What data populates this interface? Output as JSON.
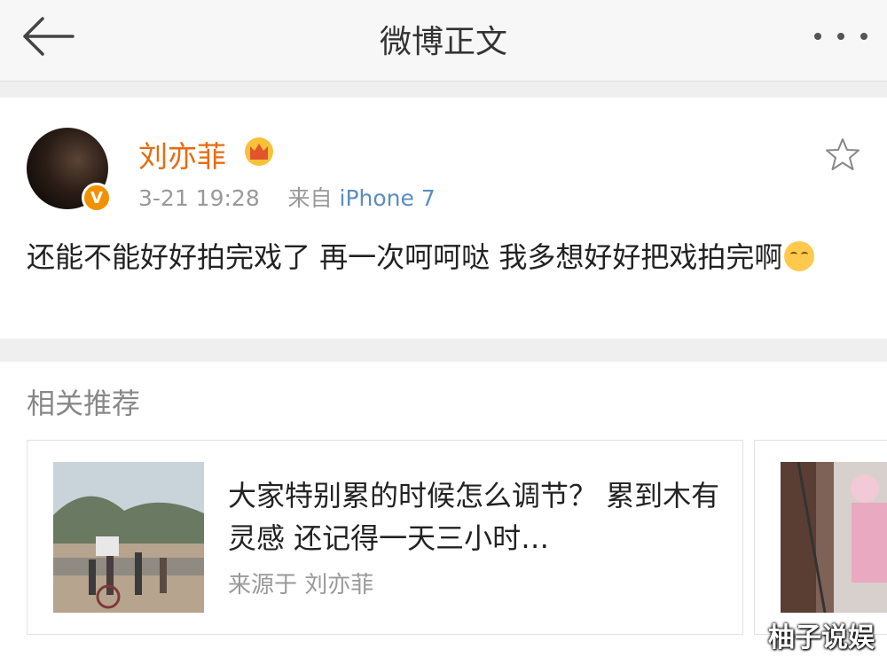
{
  "topbar": {
    "title": "微博正文",
    "back_icon": "arrow-left-icon",
    "more_icon": "more-dots-icon"
  },
  "post": {
    "username": "刘亦菲",
    "verified_badge": "V",
    "time": "3-21 19:28",
    "from_label": "来自",
    "source": "iPhone 7",
    "text": "还能不能好好拍完戏了 再一次呵呵哒 我多想好好把戏拍完啊",
    "emoji": "smile-emoji-icon",
    "favorite_icon": "star-outline-icon"
  },
  "recommend": {
    "title": "相关推荐",
    "cards": [
      {
        "title": "大家特别累的时候怎么调节？ 累到木有灵感 还记得一天三小时…",
        "source": "来源于 刘亦菲"
      }
    ]
  },
  "watermark": "柚子说娱",
  "colors": {
    "username": "#e86b0f",
    "source_link": "#5b8cc3",
    "badge": "#f29100",
    "background": "#efefef"
  }
}
